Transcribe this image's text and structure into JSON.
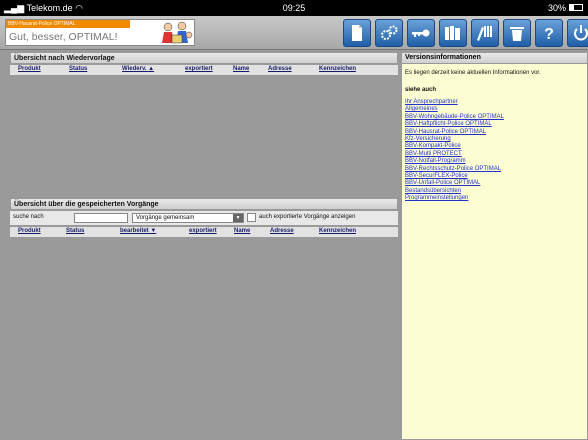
{
  "status_bar": {
    "carrier": "Telekom.de",
    "time": "09:25",
    "battery_text": "30%",
    "battery_level": 0.3
  },
  "brand": {
    "product_bar": "BBV-Hausrat-Police OPTIMAL",
    "slogan": "Gut, besser, OPTIMAL!"
  },
  "toolbar": {
    "buttons": [
      {
        "icon": "new-document-icon"
      },
      {
        "icon": "settings-icon"
      },
      {
        "icon": "key-icon"
      },
      {
        "icon": "books-icon"
      },
      {
        "icon": "edit-list-icon"
      },
      {
        "icon": "trash-icon"
      },
      {
        "icon": "help-icon",
        "label": "?"
      },
      {
        "icon": "power-icon"
      }
    ]
  },
  "resubmission": {
    "title": "Übersicht nach Wiedervorlage",
    "columns": [
      "Produkt",
      "Status",
      "Wiederv. ▲",
      "exportiert",
      "Name",
      "Adresse",
      "Kennzeichen"
    ]
  },
  "saved": {
    "title": "Übersicht über die gespeicherten Vorgänge",
    "search_label": "suche nach",
    "search_value": "",
    "filter_selected": "Vorgänge gemeinsam",
    "filter_arrow": "▼",
    "exported_checkbox_label": "auch exportierte Vorgänge anzeigen",
    "exported_checked": false,
    "columns": [
      "Produkt",
      "Status",
      "bearbeitet ▼",
      "exportiert",
      "Name",
      "Adresse",
      "Kennzeichen"
    ]
  },
  "sidebar": {
    "title": "Versionsinformationen",
    "message": "Es liegen derzeit keine aktuellen Informationen vor.",
    "see_also": "siehe auch",
    "links": [
      "Ihr Ansprechpartner",
      "Allgemeines",
      "BBV-Wohngebäude-Police OPTIMAL",
      "BBV-Haftpflicht-Police OPTIMAL",
      "BBV-Hausrat-Police OPTIMAL",
      "Kfz-Versicherung",
      "BBV-Kompakt-Police",
      "BBV-Multi PROTECT",
      "BBV-Notfall-Programm",
      "BBV-Rechtsschutz-Police OPTIMAL",
      "BBV-SecurFLEX-Police",
      "BBV-Unfall-Police OPTIMAL",
      "Bestandsübersichten",
      "Programmeinstellungen"
    ]
  },
  "colors": {
    "accent_orange": "#f08a00",
    "toolbar_blue": "#2a6ab8",
    "sidebar_bg": "#fdfdd4",
    "link_blue": "#2233cc"
  }
}
